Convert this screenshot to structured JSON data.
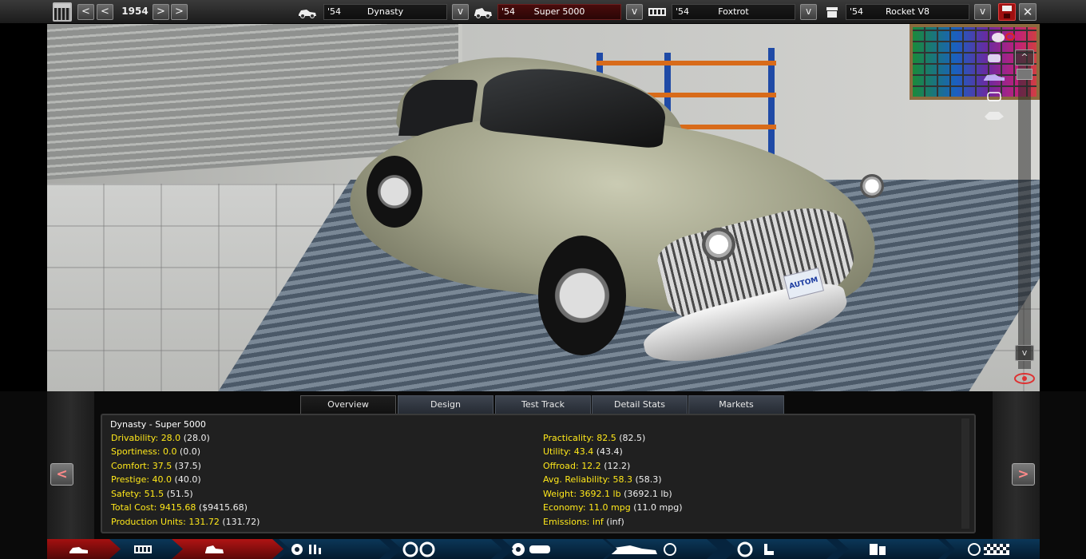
{
  "topbar": {
    "year": "1954",
    "prev2_label": "<",
    "prev_label": "<",
    "next_label": ">",
    "next2_label": ">",
    "selectors": [
      {
        "year": "'54",
        "name": "Dynasty",
        "icon": "car-model-icon",
        "dropdown": "v"
      },
      {
        "year": "'54",
        "name": "Super 5000",
        "icon": "trim-icon",
        "dropdown": "v"
      },
      {
        "year": "'54",
        "name": "Foxtrot",
        "icon": "engine-family-icon",
        "dropdown": "v"
      },
      {
        "year": "'54",
        "name": "Rocket V8",
        "icon": "engine-variant-icon",
        "dropdown": "v"
      }
    ],
    "close_label": "✕"
  },
  "scene": {
    "plate_text": "AUTOM",
    "scroll_up": "^",
    "scroll_down": "v",
    "view_icons": [
      "paint-view-icon",
      "front-view-icon",
      "side-view-icon",
      "ghost-view-icon",
      "top-view-icon"
    ]
  },
  "tabs": [
    "Overview",
    "Design",
    "Test Track",
    "Detail Stats",
    "Markets"
  ],
  "active_tab": "Overview",
  "overview": {
    "title": "Dynasty - Super 5000",
    "left_stats": [
      {
        "label": "Drivability:",
        "value": "28.0",
        "base": "(28.0)"
      },
      {
        "label": "Sportiness:",
        "value": "0.0",
        "base": "(0.0)"
      },
      {
        "label": "Comfort:",
        "value": "37.5",
        "base": "(37.5)"
      },
      {
        "label": "Prestige:",
        "value": "40.0",
        "base": "(40.0)"
      },
      {
        "label": "Safety:",
        "value": "51.5",
        "base": "(51.5)"
      },
      {
        "label": "Total Cost:",
        "value": "9415.68",
        "base": "($9415.68)"
      },
      {
        "label": "Production Units:",
        "value": "131.72",
        "base": "(131.72)"
      }
    ],
    "right_stats": [
      {
        "label": "Practicality:",
        "value": "82.5",
        "base": "(82.5)"
      },
      {
        "label": "Utility:",
        "value": "43.4",
        "base": "(43.4)"
      },
      {
        "label": "Offroad:",
        "value": "12.2",
        "base": "(12.2)"
      },
      {
        "label": "Avg. Reliability:",
        "value": "58.3",
        "base": "(58.3)"
      },
      {
        "label": "Weight:",
        "value": "3692.1 lb",
        "base": "(3692.1 lb)"
      },
      {
        "label": "Economy:",
        "value": "11.0 mpg",
        "base": "(11.0 mpg)"
      },
      {
        "label": "Emissions:",
        "value": "inf",
        "base": "(inf)"
      }
    ],
    "prev_label": "<",
    "next_label": ">"
  },
  "navbar": {
    "segments": [
      {
        "icon": "company-icon"
      },
      {
        "icon": "factory-icon"
      },
      {
        "icon": "car-design-icon"
      },
      {
        "icon": "engine-icon"
      },
      {
        "icon": "suspension-icon"
      },
      {
        "icon": "brakes-icon"
      },
      {
        "icon": "body-aero-icon"
      },
      {
        "icon": "interior-icon"
      },
      {
        "icon": "testing-icon"
      },
      {
        "icon": "finish-flag-icon"
      }
    ]
  },
  "colors": {
    "accent": "#ffe81a",
    "nav_active": "#b01414",
    "nav_bg": "#0b3758"
  }
}
